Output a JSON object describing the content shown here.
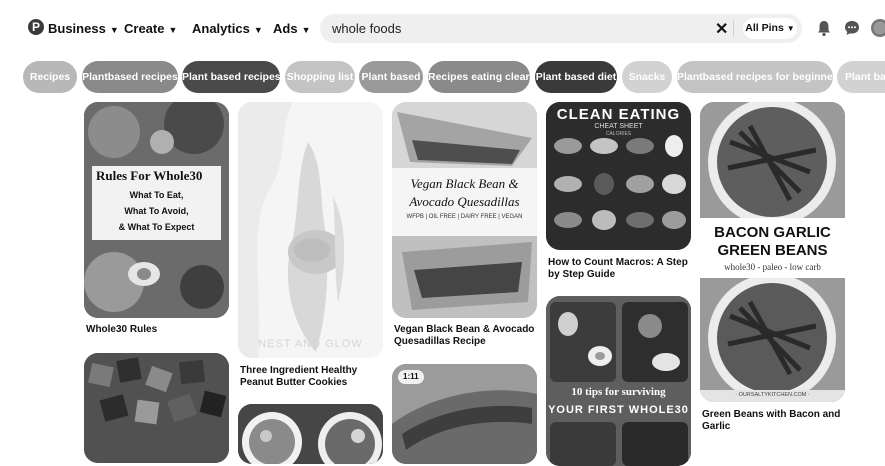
{
  "nav": {
    "logo_glyph": "P",
    "business": "Business",
    "create": "Create",
    "analytics": "Analytics",
    "ads": "Ads"
  },
  "search": {
    "query": "whole foods",
    "clear_glyph": "✕",
    "filter_label": "All Pins"
  },
  "pills": [
    "Recipes",
    "Plantbased recipes",
    "Plant based recipes",
    "Shopping list",
    "Plant based",
    "Recipes eating clean",
    "Plant based diet",
    "Snacks",
    "Plantbased recipes for beginners",
    "Plant based"
  ],
  "pins": {
    "whole30_rules": {
      "title": "Whole30 Rules",
      "overlay": [
        "Rules For Whole30",
        "What To Eat,",
        "What To Avoid,",
        "& What To Expect"
      ]
    },
    "peanut_butter_cookies": {
      "title": "Three Ingredient Healthy Peanut Butter Cookies",
      "watermark": "NEST AND GLOW"
    },
    "vegan_quesadillas": {
      "title": "Vegan Black Bean & Avocado Quesadillas Recipe",
      "overlay": [
        "Vegan Black Bean &",
        "Avocado Quesadillas",
        "WFPB | OIL FREE | DAIRY FREE | VEGAN"
      ]
    },
    "count_macros": {
      "title": "How to Count Macros: A Step by Step Guide",
      "overlay": [
        "CLEAN EATING",
        "CHEAT SHEET",
        "CALORIES"
      ]
    },
    "green_beans": {
      "title": "Green Beans with Bacon and Garlic",
      "overlay": [
        "BACON GARLIC",
        "GREEN BEANS",
        "whole30 - paleo - low carb",
        "· OURSALTYKITCHEN.COM ·"
      ]
    },
    "whole30_tips": {
      "overlay": [
        "10 tips for surviving",
        "YOUR FIRST WHOLE30"
      ]
    },
    "video_pin": {
      "duration": "1:11"
    }
  }
}
